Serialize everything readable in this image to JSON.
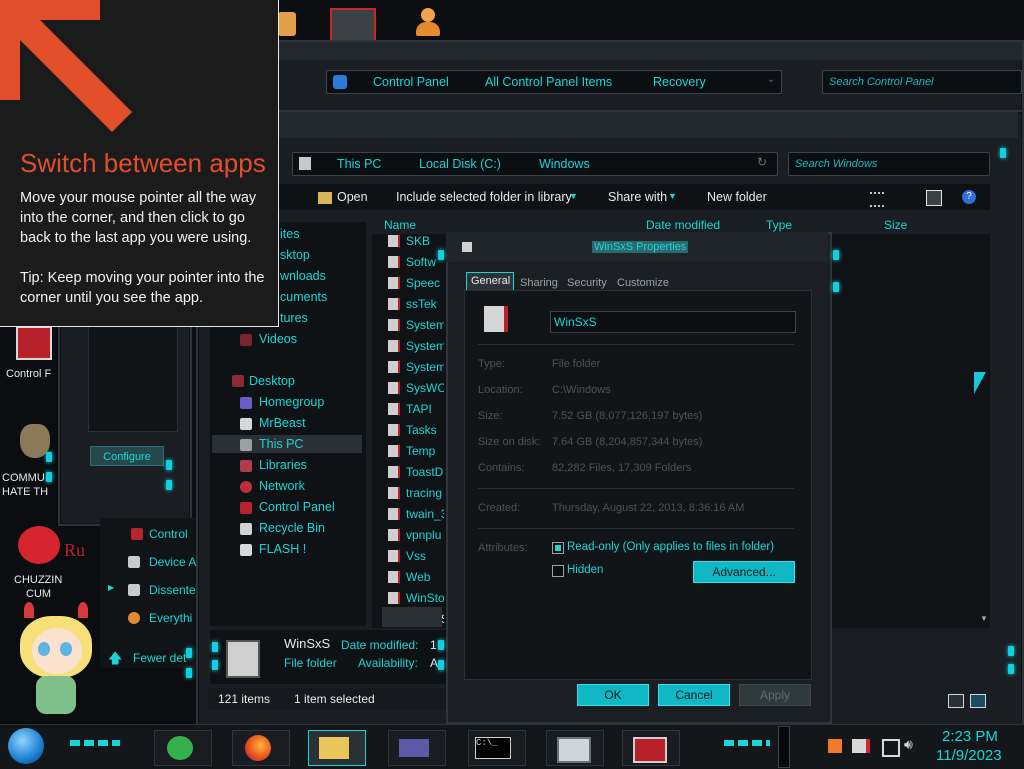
{
  "hint": {
    "title": "Switch between apps",
    "body": "Move your mouse pointer all the way into the corner, and then click to go back to the last app you were using.",
    "tip": "Tip: Keep moving your pointer into the corner until you see the app."
  },
  "control_panel_window": {
    "breadcrumb": [
      "Control Panel",
      "All Control Panel Items",
      "Recovery"
    ],
    "search_placeholder": "Search Control Panel"
  },
  "explorer": {
    "breadcrumb": [
      "This PC",
      "Local Disk (C:)",
      "Windows"
    ],
    "search_placeholder": "Search Windows",
    "toolbar": {
      "open": "Open",
      "include": "Include selected folder in library",
      "share": "Share with",
      "new_folder": "New folder"
    },
    "columns": {
      "name": "Name",
      "date": "Date modified",
      "type": "Type",
      "size": "Size"
    },
    "nav": {
      "partial": [
        "ites",
        "sktop",
        "wnloads",
        "cuments",
        "tures"
      ],
      "videos": "Videos",
      "desktop": "Desktop",
      "homegroup": "Homegroup",
      "mrbeast": "MrBeast",
      "thispc": "This PC",
      "libraries": "Libraries",
      "network": "Network",
      "controlpanel": "Control Panel",
      "recycle": "Recycle Bin",
      "flash": "FLASH !"
    },
    "files": [
      "SKB",
      "Softw",
      "Speec",
      "ssTek",
      "System",
      "System",
      "System",
      "SysWC",
      "TAPI",
      "Tasks",
      "Temp",
      "ToastD",
      "tracing",
      "twain_3",
      "vpnplu",
      "Vss",
      "Web",
      "WinSto",
      "WinSxS"
    ],
    "details": {
      "name": "WinSxS",
      "type": "File folder",
      "date_label": "Date modified:",
      "date_value": "1",
      "avail_label": "Availability:",
      "avail_value": "A"
    },
    "status": {
      "items": "121 items",
      "selected": "1 item selected"
    }
  },
  "properties": {
    "title": "WinSxS Properties",
    "tabs": [
      "General",
      "Sharing",
      "Security",
      "Customize"
    ],
    "name": "WinSxS",
    "rows": [
      {
        "label": "Type:",
        "value": "File folder"
      },
      {
        "label": "Location:",
        "value": "C:\\Windows"
      },
      {
        "label": "Size:",
        "value": "7.52 GB (8,077,126,197 bytes)"
      },
      {
        "label": "Size on disk:",
        "value": "7.64 GB (8,204,857,344 bytes)"
      },
      {
        "label": "Contains:",
        "value": "82,282 Files, 17,309 Folders"
      },
      {
        "label": "Created:",
        "value": "Thursday, August 22, 2013, 8:36:16 AM"
      }
    ],
    "attributes_label": "Attributes:",
    "readonly": "Read-only (Only applies to files in folder)",
    "hidden": "Hidden",
    "advanced": "Advanced...",
    "ok": "OK",
    "cancel": "Cancel",
    "apply": "Apply"
  },
  "left_panel": {
    "configure": "Configure",
    "list": [
      "Control",
      "Device A",
      "Dissente",
      "Everythi"
    ],
    "fewer": "Fewer det"
  },
  "desktop_icons": {
    "control": "Control F",
    "commu1": "COMMU",
    "commu2": "HATE TH",
    "chuzzin1": "CHUZZIN",
    "chuzzin2": "CUM",
    "ru": "Ru"
  },
  "clock": {
    "time": "2:23 PM",
    "date": "11/9/2023"
  }
}
